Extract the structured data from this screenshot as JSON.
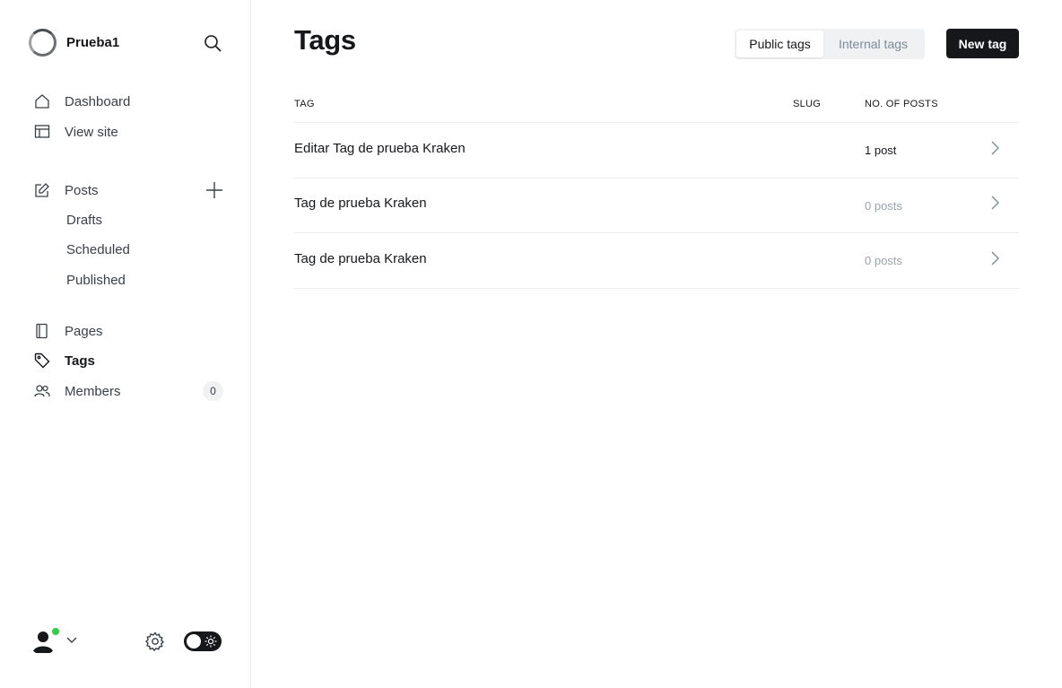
{
  "sidebar": {
    "site_name": "Prueba1",
    "nav": {
      "dashboard": "Dashboard",
      "view_site": "View site",
      "posts": "Posts",
      "drafts": "Drafts",
      "scheduled": "Scheduled",
      "published": "Published",
      "pages": "Pages",
      "tags": "Tags",
      "members": "Members",
      "members_count": "0"
    },
    "theme_toggle": "dark"
  },
  "main": {
    "title": "Tags",
    "filter_tabs": [
      {
        "label": "Public tags",
        "selected": true
      },
      {
        "label": "Internal tags",
        "selected": false
      }
    ],
    "new_tag_label": "New tag",
    "table": {
      "headers": [
        "TAG",
        "SLUG",
        "NO. OF POSTS"
      ],
      "rows": [
        {
          "name": "Editar Tag de prueba Kraken",
          "slug": "",
          "posts": "1 post"
        },
        {
          "name": "Tag de prueba Kraken",
          "slug": "",
          "posts": "0 posts"
        },
        {
          "name": "Tag de prueba Kraken",
          "slug": "",
          "posts": "0 posts"
        }
      ]
    }
  },
  "icons": {
    "search": "search-icon",
    "dashboard": "home-icon",
    "view_site": "layout-icon",
    "posts": "edit-icon",
    "add": "plus-icon",
    "pages": "page-icon",
    "tags": "tag-icon",
    "members": "members-icon",
    "settings": "gear-icon",
    "chevron": "chevron-right-icon"
  },
  "colors": {
    "accent": "#15171a",
    "online": "#30cf43",
    "muted_text": "#9aa3ab"
  }
}
